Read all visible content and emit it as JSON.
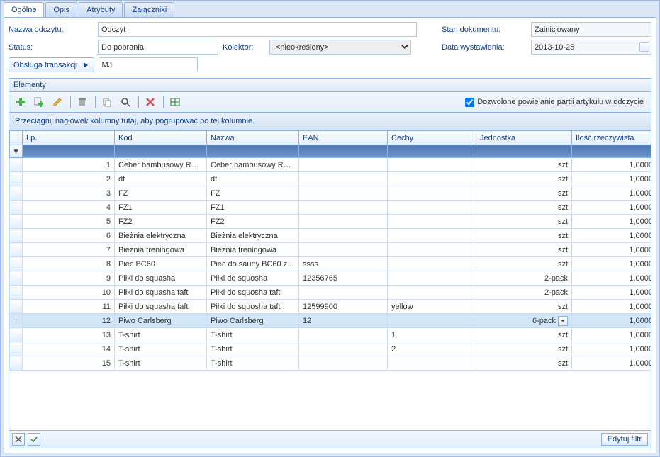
{
  "tabs": {
    "ogolne": "Ogólne",
    "opis": "Opis",
    "atrybuty": "Atrybuty",
    "zalaczniki": "Załączniki"
  },
  "form": {
    "nazwa_label": "Nazwa odczytu:",
    "nazwa_value": "Odczyt",
    "status_label": "Status:",
    "status_value": "Do pobrania",
    "kolektor_label": "Kolektor:",
    "kolektor_value": "<nieokreślony>",
    "obsluga_label": "Obsługa transakcji",
    "obsluga_value": "MJ",
    "stan_label": "Stan dokumentu:",
    "stan_value": "Zainicjowany",
    "data_label": "Data wystawienia:",
    "data_value": "2013-10-25"
  },
  "panel": {
    "title": "Elementy",
    "checkbox_label": "Dozwolone powielanie partii artykułu w odczycie",
    "group_hint": "Przeciągnij nagłówek kolumny tutaj, aby pogrupować po tej kolumnie."
  },
  "columns": {
    "lp": "Lp.",
    "kod": "Kod",
    "nazwa": "Nazwa",
    "ean": "EAN",
    "cechy": "Cechy",
    "jednostka": "Jednostka",
    "ilosc": "Ilość rzeczywista"
  },
  "rows": [
    {
      "lp": "1",
      "kod": "Ceber bambusowy Rento",
      "nazwa": "Ceber bambusowy Rento",
      "ean": "",
      "cechy": "",
      "jednostka": "szt",
      "ilosc": "1,0000"
    },
    {
      "lp": "2",
      "kod": "dt",
      "nazwa": "dt",
      "ean": "",
      "cechy": "",
      "jednostka": "szt",
      "ilosc": "1,0000"
    },
    {
      "lp": "3",
      "kod": "FZ",
      "nazwa": "FZ",
      "ean": "",
      "cechy": "",
      "jednostka": "szt",
      "ilosc": "1,0000"
    },
    {
      "lp": "4",
      "kod": "FZ1",
      "nazwa": "FZ1",
      "ean": "",
      "cechy": "",
      "jednostka": "szt",
      "ilosc": "1,0000"
    },
    {
      "lp": "5",
      "kod": "FZ2",
      "nazwa": "FZ2",
      "ean": "",
      "cechy": "",
      "jednostka": "szt",
      "ilosc": "1,0000"
    },
    {
      "lp": "6",
      "kod": "Bieżnia elektryczna",
      "nazwa": "Bieżnia elektryczna",
      "ean": "",
      "cechy": "",
      "jednostka": "szt",
      "ilosc": "1,0000"
    },
    {
      "lp": "7",
      "kod": "Bieżnia treningowa",
      "nazwa": "Bieżnia treningowa",
      "ean": "",
      "cechy": "",
      "jednostka": "szt",
      "ilosc": "1,0000"
    },
    {
      "lp": "8",
      "kod": "Piec BC60",
      "nazwa": "Piec do sauny  BC60 z...",
      "ean": "ssss",
      "cechy": "",
      "jednostka": "szt",
      "ilosc": "1,0000"
    },
    {
      "lp": "9",
      "kod": "Piłki do squasha",
      "nazwa": "Piłki do squosha",
      "ean": "12356765",
      "cechy": "",
      "jednostka": "2-pack",
      "ilosc": "1,0000"
    },
    {
      "lp": "10",
      "kod": "Piłki do squasha taft",
      "nazwa": "Piłki do squosha taft",
      "ean": "",
      "cechy": "",
      "jednostka": "2-pack",
      "ilosc": "1,0000"
    },
    {
      "lp": "11",
      "kod": "Piłki do squasha taft",
      "nazwa": "Piłki do squosha taft",
      "ean": "12599900",
      "cechy": "yellow",
      "jednostka": "szt",
      "ilosc": "1,0000"
    },
    {
      "lp": "12",
      "kod": "Piwo Carlsberg",
      "nazwa": "Piwo Carlsberg",
      "ean": "12",
      "cechy": "",
      "jednostka": "6-pack",
      "ilosc": "1,0000",
      "selected": true
    },
    {
      "lp": "13",
      "kod": "T-shirt",
      "nazwa": "T-shirt",
      "ean": "",
      "cechy": "1",
      "jednostka": "szt",
      "ilosc": "1,0000"
    },
    {
      "lp": "14",
      "kod": "T-shirt",
      "nazwa": "T-shirt",
      "ean": "",
      "cechy": "2",
      "jednostka": "szt",
      "ilosc": "1,0000"
    },
    {
      "lp": "15",
      "kod": "T-shirt",
      "nazwa": "T-shirt",
      "ean": "",
      "cechy": "",
      "jednostka": "szt",
      "ilosc": "1,0000"
    }
  ],
  "footer": {
    "edit_filter": "Edytuj filtr"
  }
}
